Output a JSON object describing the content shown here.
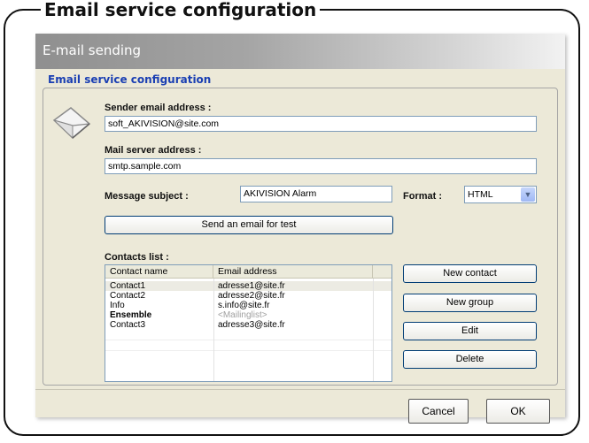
{
  "outer": {
    "title": "Email service configuration"
  },
  "window": {
    "title": "E-mail sending"
  },
  "group": {
    "legend": "Email service configuration"
  },
  "sender": {
    "label": "Sender email address :",
    "value": "soft_AKIVISION@site.com"
  },
  "server": {
    "label": "Mail server address :",
    "value": "smtp.sample.com"
  },
  "subject": {
    "label": "Message subject :",
    "value": "AKIVISION Alarm"
  },
  "format": {
    "label": "Format :",
    "value": "HTML"
  },
  "test_button": "Send an email for test",
  "contacts": {
    "label": "Contacts list :",
    "headers": [
      "Contact name",
      "Email address"
    ],
    "rows": [
      {
        "name": "Contact1",
        "email": "adresse1@site.fr"
      },
      {
        "name": "Contact2",
        "email": "adresse2@site.fr"
      },
      {
        "name": "Info",
        "email": "s.info@site.fr"
      },
      {
        "name": "Ensemble",
        "email": "<Mailinglist>"
      },
      {
        "name": "Contact3",
        "email": "adresse3@site.fr"
      }
    ]
  },
  "actions": {
    "new_contact": "New contact",
    "new_group": "New group",
    "edit": "Edit",
    "delete": "Delete"
  },
  "footer": {
    "cancel": "Cancel",
    "ok": "OK"
  },
  "colors": {
    "legend": "#1a3fb3",
    "window_bg": "#ece9d8",
    "button_border": "#003c74"
  }
}
